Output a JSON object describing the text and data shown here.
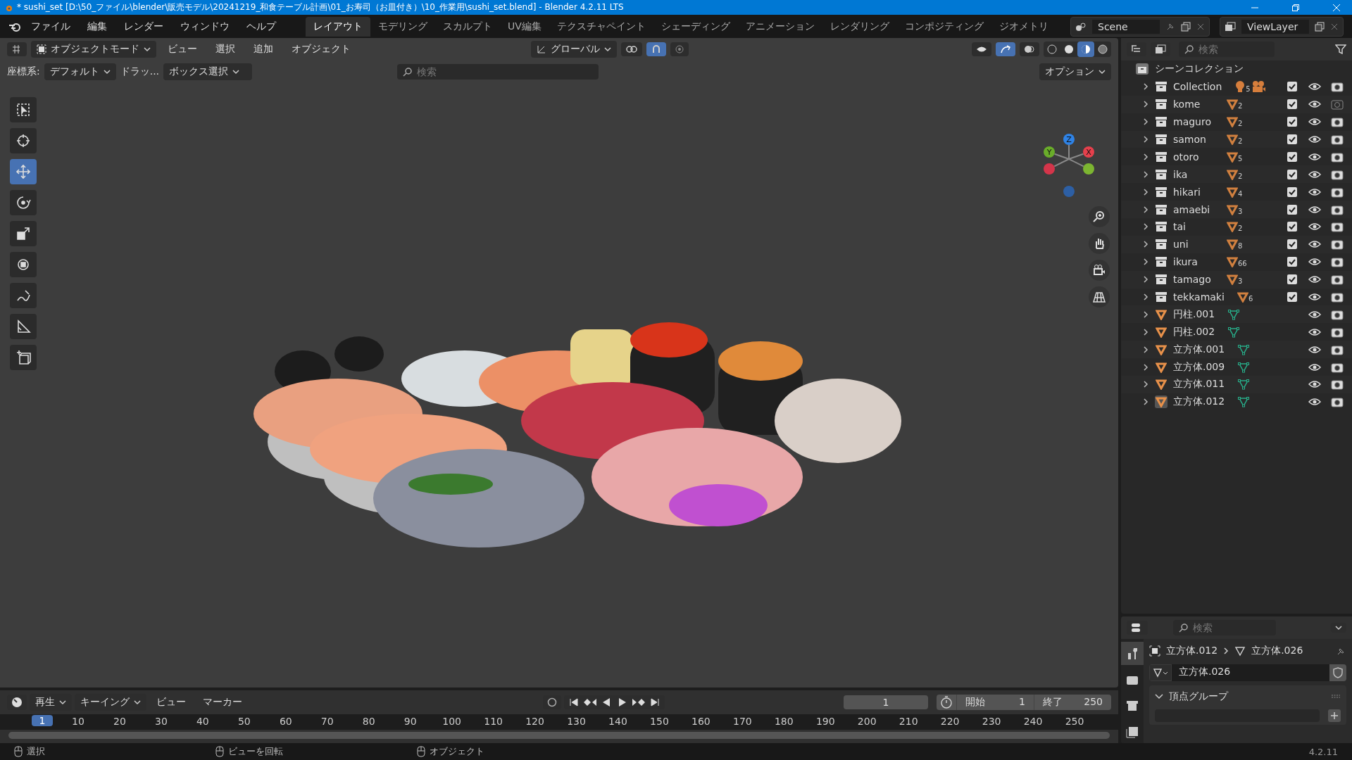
{
  "window": {
    "title": "* sushi_set [D:\\50_ファイル\\blender\\販売モデル\\20241219_和食テーブル計画\\01_お寿司（お皿付き）\\10_作業用\\sushi_set.blend] - Blender 4.2.11 LTS"
  },
  "menu": [
    "ファイル",
    "編集",
    "レンダー",
    "ウィンドウ",
    "ヘルプ"
  ],
  "workspaces": [
    {
      "label": "レイアウト",
      "selected": true
    },
    {
      "label": "モデリング",
      "selected": false
    },
    {
      "label": "スカルプト",
      "selected": false
    },
    {
      "label": "UV編集",
      "selected": false
    },
    {
      "label": "テクスチャペイント",
      "selected": false
    },
    {
      "label": "シェーディング",
      "selected": false
    },
    {
      "label": "アニメーション",
      "selected": false
    },
    {
      "label": "レンダリング",
      "selected": false
    },
    {
      "label": "コンポジティング",
      "selected": false
    },
    {
      "label": "ジオメトリ",
      "selected": false
    }
  ],
  "scene": "Scene",
  "view_layer": "ViewLayer",
  "viewport": {
    "mode": "オブジェクトモード",
    "menus": [
      "ビュー",
      "選択",
      "追加",
      "オブジェクト"
    ],
    "transform": "グローバル",
    "coord_label": "座標系:",
    "coord_value": "デフォルト",
    "drag": "ドラッ...",
    "select_mode": "ボックス選択",
    "search_placeholder": "検索",
    "options": "オプション",
    "snap_on": true,
    "shading": [
      {
        "kind": "wire",
        "selected": false
      },
      {
        "kind": "solid",
        "selected": false
      },
      {
        "kind": "material",
        "selected": true
      },
      {
        "kind": "rendered",
        "selected": false
      }
    ],
    "gizmo": {
      "z": "Z",
      "x": "X",
      "y": "Y"
    }
  },
  "tools": [
    {
      "kind": "select",
      "selected": false
    },
    {
      "kind": "cursor",
      "selected": false
    },
    {
      "kind": "move",
      "selected": true
    },
    {
      "kind": "rotate",
      "selected": false
    },
    {
      "kind": "scale",
      "selected": false
    },
    {
      "kind": "transform",
      "selected": false
    },
    {
      "kind": "annotate",
      "selected": false
    },
    {
      "kind": "measure",
      "selected": false
    },
    {
      "kind": "add-cube",
      "selected": false
    }
  ],
  "outliner": {
    "search_placeholder": "検索",
    "root": "シーンコレクション",
    "items": [
      {
        "kind": "collection",
        "name": "Collection",
        "light_count": "5",
        "camera": true,
        "included": true,
        "renderable": true
      },
      {
        "kind": "collection",
        "name": "kome",
        "mesh_count": "2",
        "included": true,
        "renderable": false
      },
      {
        "kind": "collection",
        "name": "maguro",
        "mesh_count": "2",
        "included": true,
        "renderable": true
      },
      {
        "kind": "collection",
        "name": "samon",
        "mesh_count": "2",
        "included": true,
        "renderable": true
      },
      {
        "kind": "collection",
        "name": "otoro",
        "mesh_count": "5",
        "included": true,
        "renderable": true
      },
      {
        "kind": "collection",
        "name": "ika",
        "mesh_count": "2",
        "included": true,
        "renderable": true
      },
      {
        "kind": "collection",
        "name": "hikari",
        "mesh_count": "4",
        "included": true,
        "renderable": true
      },
      {
        "kind": "collection",
        "name": "amaebi",
        "mesh_count": "3",
        "included": true,
        "renderable": true
      },
      {
        "kind": "collection",
        "name": "tai",
        "mesh_count": "2",
        "included": true,
        "renderable": true
      },
      {
        "kind": "collection",
        "name": "uni",
        "mesh_count": "8",
        "included": true,
        "renderable": true
      },
      {
        "kind": "collection",
        "name": "ikura",
        "mesh_count": "66",
        "included": true,
        "renderable": true
      },
      {
        "kind": "collection",
        "name": "tamago",
        "mesh_count": "3",
        "included": true,
        "renderable": true
      },
      {
        "kind": "collection",
        "name": "tekkamaki",
        "mesh_count": "6",
        "included": true,
        "renderable": true
      },
      {
        "kind": "object",
        "name": "円柱.001",
        "renderable": true,
        "selected": false
      },
      {
        "kind": "object",
        "name": "円柱.002",
        "renderable": true,
        "selected": false
      },
      {
        "kind": "object",
        "name": "立方体.001",
        "renderable": true,
        "selected": false
      },
      {
        "kind": "object",
        "name": "立方体.009",
        "renderable": true,
        "selected": false
      },
      {
        "kind": "object",
        "name": "立方体.011",
        "renderable": true,
        "selected": false
      },
      {
        "kind": "object",
        "name": "立方体.012",
        "renderable": true,
        "selected": true
      }
    ]
  },
  "properties": {
    "search_placeholder": "検索",
    "tabs": [
      {
        "kind": "tool",
        "selected": true
      },
      {
        "kind": "render",
        "selected": false
      },
      {
        "kind": "output",
        "selected": false
      },
      {
        "kind": "view-layer",
        "selected": false
      }
    ],
    "object": "立方体.012",
    "mesh": "立方体.026",
    "data_name": "立方体.026",
    "panel": "頂点グループ"
  },
  "timeline": {
    "menus": [
      {
        "label": "再生",
        "kind": "dropdown"
      },
      {
        "label": "キーイング",
        "kind": "dropdown"
      },
      {
        "label": "ビュー",
        "kind": "menu"
      },
      {
        "label": "マーカー",
        "kind": "menu"
      }
    ],
    "current_frame": "1",
    "start_label": "開始",
    "start": "1",
    "end_label": "終了",
    "end": "250",
    "playhead": "1",
    "ticks": [
      "10",
      "20",
      "30",
      "40",
      "50",
      "60",
      "70",
      "80",
      "90",
      "100",
      "110",
      "120",
      "130",
      "140",
      "150",
      "160",
      "170",
      "180",
      "190",
      "200",
      "210",
      "220",
      "230",
      "240",
      "250"
    ]
  },
  "status": {
    "hints": [
      "選択",
      "ビューを回転",
      "オブジェクト"
    ],
    "version": "4.2.11"
  }
}
